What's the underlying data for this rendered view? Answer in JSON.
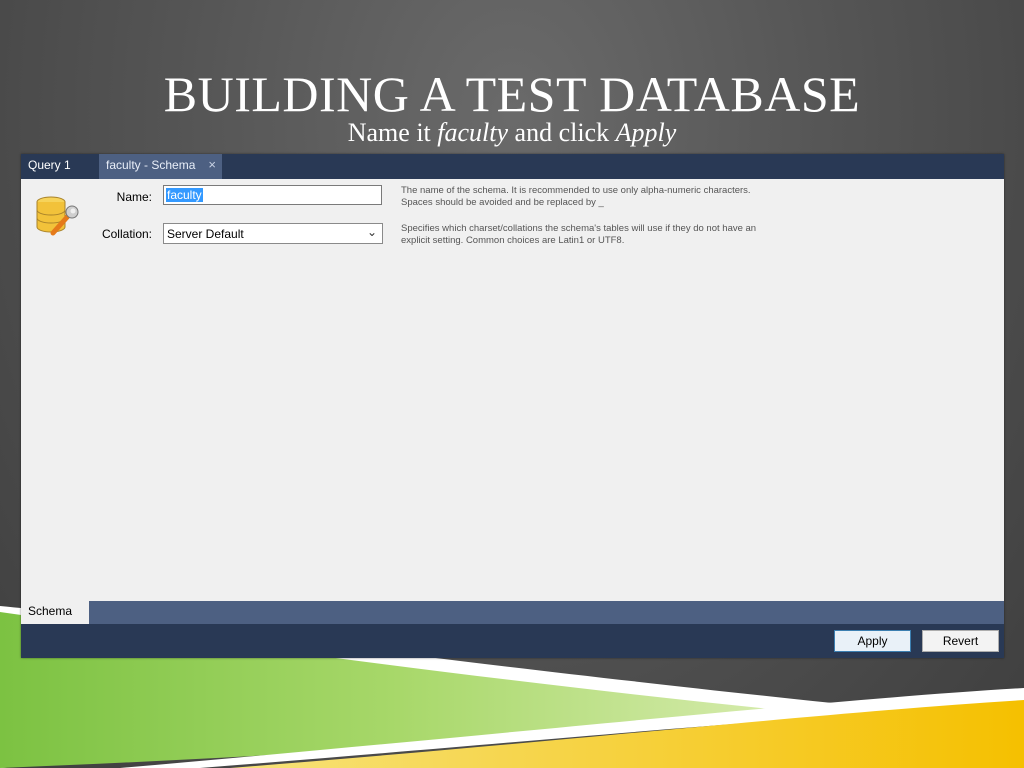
{
  "slide": {
    "title": "BUILDING A TEST DATABASE",
    "subtitle_prefix": "Name it ",
    "subtitle_name": "faculty",
    "subtitle_middle": " and click ",
    "subtitle_action": "Apply"
  },
  "tabs": [
    {
      "label": "Query 1"
    },
    {
      "label": "faculty - Schema",
      "close": "×"
    }
  ],
  "form": {
    "name_label": "Name:",
    "name_value": "faculty",
    "collation_label": "Collation:",
    "collation_value": "Server Default",
    "name_help": "The name of the schema. It is recommended to use only alpha-numeric characters. Spaces should be avoided and be replaced by _",
    "collation_help": "Specifies which charset/collations the schema's tables will use if they do not have an explicit setting. Common choices are Latin1 or UTF8."
  },
  "bottom_tab": "Schema",
  "buttons": {
    "apply": "Apply",
    "revert": "Revert"
  },
  "icons": {
    "schema": "database-wrench-icon",
    "dropdown": "chevron-down-icon",
    "close": "close-icon"
  },
  "colors": {
    "tabbar": "#293955",
    "active_tab": "#4d6082",
    "selection": "#3399ff"
  }
}
